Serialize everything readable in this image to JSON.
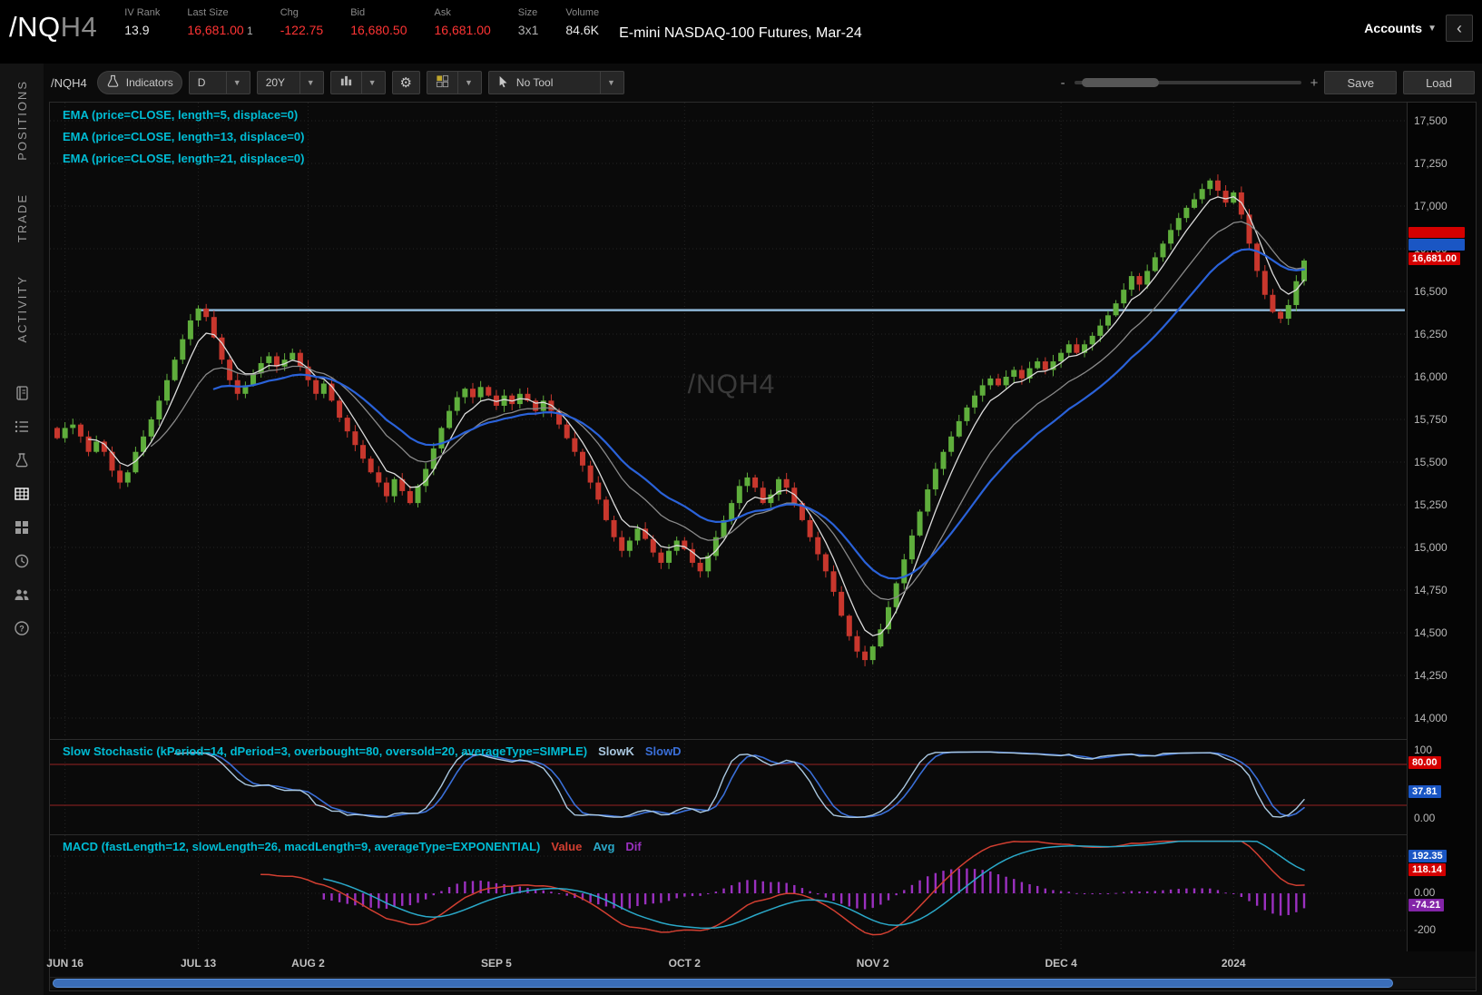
{
  "palette": {
    "up": "#5fae3c",
    "down": "#c8372d",
    "quote_red": "#ff3434",
    "quote_white": "#e8e8e8",
    "quote_gray": "#b0b0b0",
    "ema5": "#dcdcdc",
    "ema13": "#8a8a8a",
    "ema21": "#2a62d9",
    "hline": "#8fb8d8",
    "slowk": "#aac8e0",
    "slowd": "#3a6fd8",
    "macd_value": "#d23f31",
    "macd_avg": "#2aa8c8",
    "macd_diff": "#9b30c0",
    "badge_red": "#d40000",
    "badge_blue": "#1a56c4",
    "badge_purple": "#8324a8",
    "label_cyan": "#00bcd4",
    "ob_os_line": "#7a1f1f"
  },
  "header": {
    "symbol": "/NQ",
    "symbol_suffix": "H4",
    "fields": [
      {
        "label": "IV Rank",
        "value": "13.9",
        "color": "white"
      },
      {
        "label": "Last Size",
        "value": "16,681.00",
        "suffix": "1",
        "color": "red"
      },
      {
        "label": "Chg",
        "value": "-122.75",
        "color": "red"
      },
      {
        "label": "Bid",
        "value": "16,680.50",
        "color": "red"
      },
      {
        "label": "Ask",
        "value": "16,681.00",
        "color": "red"
      },
      {
        "label": "Size",
        "value": "3x1",
        "color": "gray"
      },
      {
        "label": "Volume",
        "value": "84.6K",
        "color": "white"
      }
    ],
    "title": "E-mini NASDAQ-100 Futures, Mar-24",
    "accounts_label": "Accounts",
    "collapse_glyph": "‹"
  },
  "sidebar": {
    "tabs": [
      {
        "label": "POSITIONS"
      },
      {
        "label": "TRADE"
      },
      {
        "label": "ACTIVITY"
      }
    ],
    "icons": [
      {
        "name": "journal-icon",
        "active": false
      },
      {
        "name": "list-icon",
        "active": false
      },
      {
        "name": "flask-icon",
        "active": false
      },
      {
        "name": "table-icon",
        "active": true
      },
      {
        "name": "grid-icon",
        "active": false
      },
      {
        "name": "clock-icon",
        "active": false
      },
      {
        "name": "people-icon",
        "active": false
      },
      {
        "name": "help-icon",
        "active": false
      }
    ]
  },
  "toolbar": {
    "symbol": "/NQH4",
    "indicators": "Indicators",
    "timeframe": "D",
    "range": "20Y",
    "tool": "No Tool",
    "save": "Save",
    "load": "Load",
    "zoom_minus": "-",
    "zoom_plus": "+"
  },
  "chart": {
    "ema_labels": [
      "EMA (price=CLOSE, length=5, displace=0)",
      "EMA (price=CLOSE, length=13, displace=0)",
      "EMA (price=CLOSE, length=21, displace=0)"
    ],
    "watermark": "/NQH4",
    "last_price_badge": "16,681.00"
  },
  "stoch": {
    "label": "Slow Stochastic (kPeriod=14, dPeriod=3, overbought=80, oversold=20, averageType=SIMPLE)",
    "legend": [
      {
        "label": "SlowK",
        "color": "slowk"
      },
      {
        "label": "SlowD",
        "color": "slowd"
      }
    ],
    "axis_top": "100",
    "axis_bottom": "0.00",
    "badges": [
      {
        "text": "80.00",
        "value": 80,
        "bg": "badge_red"
      },
      {
        "text": "37.81",
        "value": 37.81,
        "bg": "badge_blue"
      }
    ]
  },
  "macd": {
    "label": "MACD (fastLength=12, slowLength=26, macdLength=9, averageType=EXPONENTIAL)",
    "legend": [
      {
        "label": "Value",
        "color": "macd_value"
      },
      {
        "label": "Avg",
        "color": "macd_avg"
      },
      {
        "label": "Dif",
        "color": "macd_diff"
      }
    ],
    "axis_mid": "0.00",
    "axis_bottom": "-200",
    "badges": [
      {
        "text": "192.35",
        "value": 192.35,
        "bg": "badge_blue"
      },
      {
        "text": "118.14",
        "value": 118.14,
        "bg": "badge_red"
      },
      {
        "text": "-74.21",
        "value": -74.21,
        "bg": "badge_purple"
      }
    ]
  },
  "chart_data": {
    "type": "candlestick",
    "symbol": "/NQH4",
    "title": "E-mini NASDAQ-100 Futures, Mar-24",
    "price_axis": {
      "min": 14000,
      "max": 17500,
      "step": 250,
      "tick_labels": [
        "17,500",
        "17,250",
        "17,000",
        "16,750",
        "16,500",
        "16,250",
        "16,000",
        "15,750",
        "15,500",
        "15,250",
        "15,000",
        "14,750",
        "14,500",
        "14,250",
        "14,000"
      ]
    },
    "horizontal_line": 16390,
    "last_price": 16681.0,
    "first_open": 15700,
    "closes": [
      15640,
      15700,
      15720,
      15650,
      15560,
      15620,
      15560,
      15450,
      15380,
      15440,
      15560,
      15650,
      15750,
      15860,
      15980,
      16100,
      16220,
      16330,
      16400,
      16350,
      16230,
      16100,
      15980,
      15900,
      15950,
      16020,
      16080,
      16120,
      16060,
      16100,
      16140,
      16060,
      15980,
      15900,
      15960,
      15860,
      15760,
      15680,
      15600,
      15520,
      15440,
      15380,
      15300,
      15400,
      15330,
      15260,
      15360,
      15460,
      15580,
      15700,
      15800,
      15880,
      15930,
      15880,
      15940,
      15890,
      15830,
      15890,
      15840,
      15900,
      15860,
      15800,
      15860,
      15800,
      15720,
      15640,
      15560,
      15480,
      15380,
      15280,
      15160,
      15060,
      14980,
      15040,
      15110,
      15050,
      14970,
      14910,
      14980,
      15040,
      14990,
      14910,
      14860,
      14950,
      15060,
      15160,
      15260,
      15360,
      15410,
      15350,
      15260,
      15310,
      15400,
      15350,
      15260,
      15160,
      15060,
      14960,
      14860,
      14740,
      14600,
      14480,
      14390,
      14340,
      14420,
      14520,
      14650,
      14790,
      14930,
      15070,
      15210,
      15340,
      15460,
      15560,
      15650,
      15740,
      15820,
      15890,
      15950,
      15990,
      15950,
      16000,
      16040,
      15990,
      16050,
      16090,
      16040,
      16090,
      16140,
      16190,
      16140,
      16190,
      16240,
      16300,
      16360,
      16430,
      16510,
      16590,
      16540,
      16620,
      16700,
      16780,
      16860,
      16930,
      16990,
      17040,
      17100,
      17150,
      17090,
      17020,
      17080,
      16950,
      16780,
      16620,
      16480,
      16380,
      16340,
      16420,
      16560,
      16681
    ],
    "indicators": {
      "ema_lengths": [
        5,
        13,
        21
      ],
      "stoch": {
        "kPeriod": 14,
        "dPeriod": 3,
        "overbought": 80,
        "oversold": 20,
        "averageType": "SIMPLE"
      },
      "macd": {
        "fastLength": 12,
        "slowLength": 26,
        "macdLength": 9,
        "averageType": "EXPONENTIAL"
      }
    },
    "time_ticks": [
      {
        "label": "JUN 16",
        "i": 1
      },
      {
        "label": "JUL 13",
        "i": 18
      },
      {
        "label": "AUG 2",
        "i": 32
      },
      {
        "label": "SEP 5",
        "i": 56
      },
      {
        "label": "OCT 2",
        "i": 80
      },
      {
        "label": "NOV 2",
        "i": 104
      },
      {
        "label": "DEC 4",
        "i": 128
      },
      {
        "label": "2024",
        "i": 150
      }
    ]
  }
}
